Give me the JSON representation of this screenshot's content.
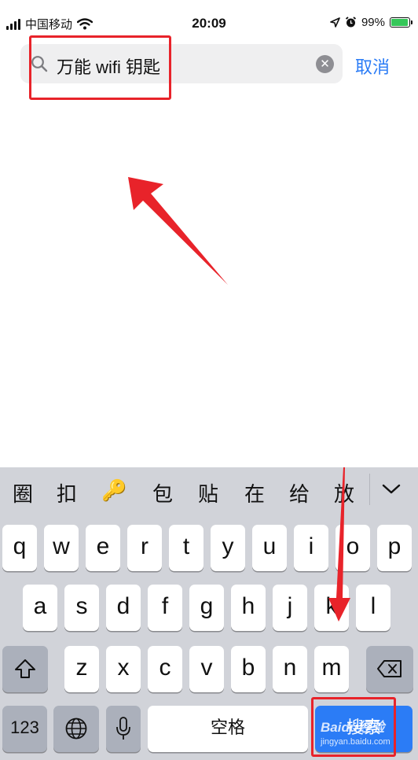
{
  "status_bar": {
    "carrier": "中国移动",
    "time": "20:09",
    "battery_percent_label": "99%",
    "battery_level": 0.99,
    "icons": [
      "signal-icon",
      "wifi-icon",
      "location-arrow-icon",
      "alarm-icon",
      "battery-charging-icon"
    ]
  },
  "search": {
    "query": "万能 wifi 钥匙",
    "cancel_label": "取消"
  },
  "keyboard": {
    "candidates": [
      "圈",
      "扣",
      "🔑",
      "包",
      "贴",
      "在",
      "给",
      "放"
    ],
    "row1": [
      "q",
      "w",
      "e",
      "r",
      "t",
      "y",
      "u",
      "i",
      "o",
      "p"
    ],
    "row2": [
      "a",
      "s",
      "d",
      "f",
      "g",
      "h",
      "j",
      "k",
      "l"
    ],
    "row3": [
      "z",
      "x",
      "c",
      "v",
      "b",
      "n",
      "m"
    ],
    "numbers_label": "123",
    "space_label": "空格",
    "search_label": "搜索"
  },
  "watermark": {
    "brand": "Baidu经验",
    "url": "jingyan.baidu.com"
  },
  "colors": {
    "accent": "#2b7cf6",
    "annotation": "#e8232a",
    "keyboard_bg": "#d1d3d9"
  }
}
